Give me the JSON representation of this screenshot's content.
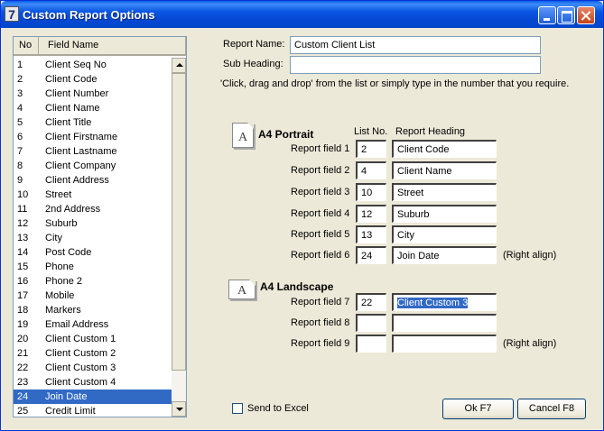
{
  "window": {
    "title": "Custom Report Options",
    "app_icon": "7"
  },
  "list": {
    "headers": {
      "no": "No",
      "name": "Field Name"
    },
    "rows": [
      {
        "no": "1",
        "name": "Client Seq No"
      },
      {
        "no": "2",
        "name": "Client Code"
      },
      {
        "no": "3",
        "name": "Client Number"
      },
      {
        "no": "4",
        "name": "Client Name"
      },
      {
        "no": "5",
        "name": "Client Title"
      },
      {
        "no": "6",
        "name": "Client Firstname"
      },
      {
        "no": "7",
        "name": "Client Lastname"
      },
      {
        "no": "8",
        "name": "Client Company"
      },
      {
        "no": "9",
        "name": "Client Address"
      },
      {
        "no": "10",
        "name": "Street"
      },
      {
        "no": "11",
        "name": "2nd Address"
      },
      {
        "no": "12",
        "name": "Suburb"
      },
      {
        "no": "13",
        "name": "City"
      },
      {
        "no": "14",
        "name": "Post Code"
      },
      {
        "no": "15",
        "name": "Phone"
      },
      {
        "no": "16",
        "name": "Phone 2"
      },
      {
        "no": "17",
        "name": "Mobile"
      },
      {
        "no": "18",
        "name": "Markers"
      },
      {
        "no": "19",
        "name": "Email Address"
      },
      {
        "no": "20",
        "name": "Client Custom 1"
      },
      {
        "no": "21",
        "name": "Client Custom 2"
      },
      {
        "no": "22",
        "name": "Client Custom 3"
      },
      {
        "no": "23",
        "name": "Client Custom 4"
      },
      {
        "no": "24",
        "name": "Join Date"
      },
      {
        "no": "25",
        "name": "Credit Limit"
      }
    ],
    "selected_no": "24"
  },
  "form": {
    "report_name_label": "Report Name:",
    "report_name_value": "Custom Client List",
    "sub_heading_label": "Sub Heading:",
    "sub_heading_value": "",
    "instruction": "'Click, drag and drop' from the list or simply type in the number that you require."
  },
  "portrait": {
    "title": "A4 Portrait",
    "col_list_no": "List No.",
    "col_heading": "Report Heading",
    "fields": [
      {
        "label": "Report field 1",
        "no": "2",
        "heading": "Client Code",
        "note": ""
      },
      {
        "label": "Report field 2",
        "no": "4",
        "heading": "Client Name",
        "note": ""
      },
      {
        "label": "Report field 3",
        "no": "10",
        "heading": "Street",
        "note": ""
      },
      {
        "label": "Report field 4",
        "no": "12",
        "heading": "Suburb",
        "note": ""
      },
      {
        "label": "Report field 5",
        "no": "13",
        "heading": "City",
        "note": ""
      },
      {
        "label": "Report field 6",
        "no": "24",
        "heading": "Join Date",
        "note": "(Right align)"
      }
    ]
  },
  "landscape": {
    "title": "A4 Landscape",
    "fields": [
      {
        "label": "Report field 7",
        "no": "22",
        "heading": "Client Custom 3",
        "note": ""
      },
      {
        "label": "Report field 8",
        "no": "",
        "heading": "",
        "note": ""
      },
      {
        "label": "Report field 9",
        "no": "",
        "heading": "",
        "note": "(Right align)"
      }
    ]
  },
  "icon_letter": "A",
  "footer": {
    "send_to_excel": "Send to Excel",
    "ok": "Ok F7",
    "cancel": "Cancel F8"
  }
}
